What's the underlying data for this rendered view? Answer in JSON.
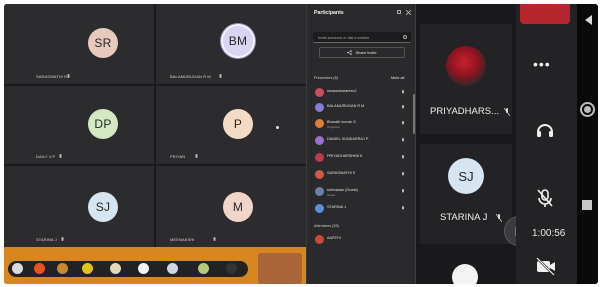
{
  "grid": {
    "tiles": [
      {
        "initials": "SR",
        "name": "SARASWATHI R",
        "color": "#e8c9bd"
      },
      {
        "initials": "BM",
        "name": "BALAMURUGAN R M",
        "color": "#d9d4f1"
      },
      {
        "initials": "DP",
        "name": "DAILY V.P",
        "color": "#d3e8c3"
      },
      {
        "initials": "P",
        "name": "PRIYAN",
        "color": "#f3dcc5"
      },
      {
        "initials": "SJ",
        "name": "STARINA J",
        "color": "#d5e5f2"
      },
      {
        "initials": "M",
        "name": "MEENAKSHI",
        "color": "#f1d5c8"
      }
    ]
  },
  "panel": {
    "title": "Participants",
    "search_placeholder": "Invite someone or dial a number",
    "share_label": "Share invite",
    "presenters_label": "Presenters (6)",
    "mute_all_label": "Mute all",
    "attendees_label": "Attendees (28)",
    "participants": [
      {
        "name": "sivasankaranrsv2",
        "sub": "",
        "color": "#d14a5f"
      },
      {
        "name": "BALAMURUGAN R M",
        "sub": "",
        "color": "#8b7bd2"
      },
      {
        "name": "Bharath kumar G",
        "sub": "Organizer",
        "color": "#e07d3a"
      },
      {
        "name": "DANIEL SUNDARRAJ P",
        "sub": "",
        "color": "#9b6fd0"
      },
      {
        "name": "PRIYADHARSHINI K",
        "sub": "",
        "color": "#c0394e"
      },
      {
        "name": "SARASWATHI S",
        "sub": "",
        "color": "#cf5a46"
      },
      {
        "name": "srinivasan (Guest)",
        "sub": "Guest",
        "color": "#6c7fa8"
      },
      {
        "name": "STARINA J",
        "sub": "",
        "color": "#5c8fd4"
      },
      {
        "name": "AARTHI",
        "sub": "",
        "color": "#c84b3a"
      }
    ]
  },
  "right": {
    "top_name": "PRIYADHARS...",
    "bottom_initials": "SJ",
    "bottom_name": "STARINA J",
    "timer": "1:00:56"
  }
}
